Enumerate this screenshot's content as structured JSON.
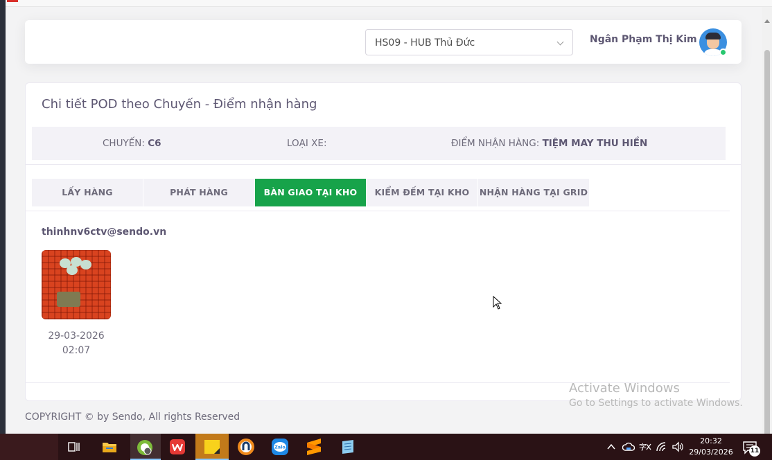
{
  "navbar": {
    "hub_select_value": "HS09 - HUB Thủ Đức",
    "user_name": "Ngân Phạm Thị Kim"
  },
  "card": {
    "title": "Chi tiết POD theo Chuyến - Điểm nhận hàng",
    "info": {
      "trip_label": "CHUYẾN:",
      "trip_value": "C6",
      "vehicle_label": "LOẠI XE:",
      "vehicle_value": "",
      "pickup_label": "ĐIỂM NHẬN HÀNG:",
      "pickup_value": "TIỆM MAY THU HIỀN"
    },
    "tabs": [
      {
        "label": "LẤY HÀNG",
        "active": false
      },
      {
        "label": "PHÁT HÀNG",
        "active": false
      },
      {
        "label": "BÀN GIAO TẠI KHO",
        "active": true
      },
      {
        "label": "KIỂM ĐẾM TẠI KHO",
        "active": false
      },
      {
        "label": "NHẬN HÀNG TẠI GRID",
        "active": false
      }
    ],
    "pod": {
      "email": "thinhnv6ctv@sendo.vn",
      "date": "29-03-2026",
      "time": "02:07"
    }
  },
  "footer": {
    "copyright": "COPYRIGHT © by Sendo, All rights Reserved"
  },
  "watermark": {
    "line1": "Activate Windows",
    "line2": "Go to Settings to activate Windows."
  },
  "taskbar": {
    "time": "20:32",
    "date": "29/03/2026",
    "notification_count": "11",
    "icons": [
      "task-view-icon",
      "file-explorer-icon",
      "coccoc-browser-icon",
      "wps-office-icon",
      "sticky-notes-icon",
      "ultraviewer-icon",
      "zalo-icon",
      "sublime-icon",
      "notepad-icon"
    ]
  },
  "colors": {
    "active_tab": "#17a34a",
    "online_status": "#28c76f"
  }
}
